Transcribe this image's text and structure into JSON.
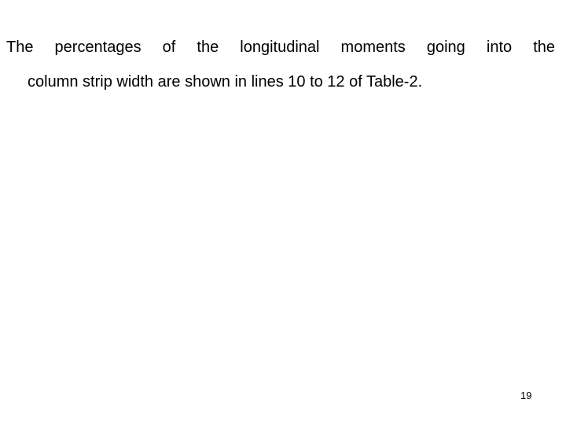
{
  "document": {
    "paragraph": {
      "lines": [
        "The percentages of the longitudinal moments going into the",
        "column strip width are shown in lines 10 to 12 of Table-2."
      ]
    },
    "page_number": "19"
  }
}
